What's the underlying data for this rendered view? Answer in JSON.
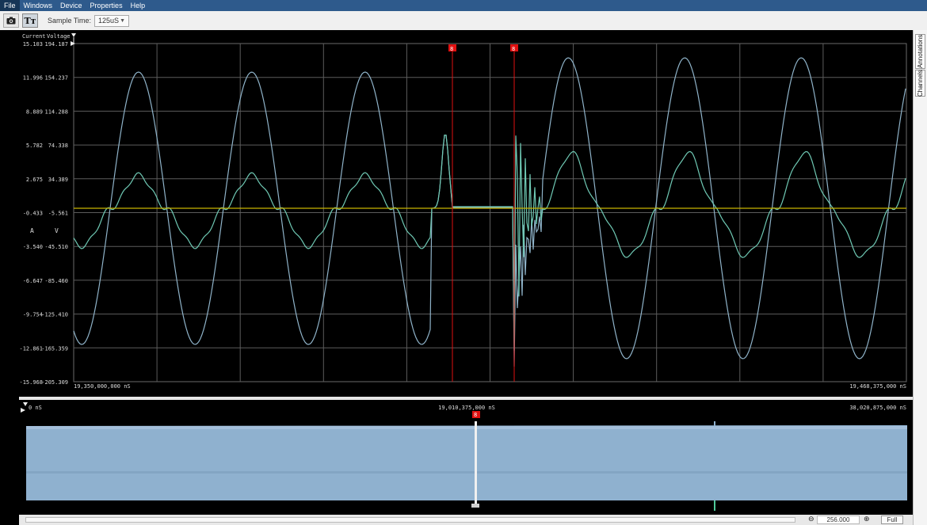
{
  "menu": {
    "items": [
      "File",
      "Windows",
      "Device",
      "Properties",
      "Help"
    ]
  },
  "toolbar": {
    "camera_icon": "camera-icon",
    "text_toggle_label": "Tт",
    "sample_time_label": "Sample Time:",
    "sample_time_value": "125uS"
  },
  "side_tabs": {
    "annotations": "Annotations",
    "channels": "Channels"
  },
  "main_plot": {
    "current_header": "Current",
    "voltage_header": "Voltage",
    "current_ticks": [
      "15.103",
      "11.996",
      "8.889",
      "5.782",
      "2.675",
      "-0.433",
      "-3.540",
      "-6.647",
      "-9.754",
      "-12.861",
      "-15.968"
    ],
    "voltage_ticks": [
      "194.187",
      "154.237",
      "114.288",
      "74.338",
      "34.389",
      "-5.561",
      "-45.510",
      "-85.460",
      "-125.410",
      "-165.359",
      "-205.309"
    ],
    "current_unit": "A",
    "voltage_unit": "V",
    "time_start": "19,350,000,000 nS",
    "time_end": "19,468,375,000 nS",
    "cursor_left_label": "8",
    "cursor_right_label": "8"
  },
  "overview": {
    "time_start": "0 nS",
    "time_mid": "19,010,375,000 nS",
    "time_end": "38,020,875,000 nS",
    "cursor_label": "8"
  },
  "bottom": {
    "zoom_value": "256.000",
    "full_label": "Full"
  },
  "colors": {
    "voltage_trace": "#8fb3c9",
    "current_trace": "#6fc9b4",
    "zero_line": "#c8b400",
    "cursor": "#e01010",
    "grid": "#6a6a6a",
    "overview_fill": "#8fb1cf",
    "menubar": "#2e5a8c"
  }
}
